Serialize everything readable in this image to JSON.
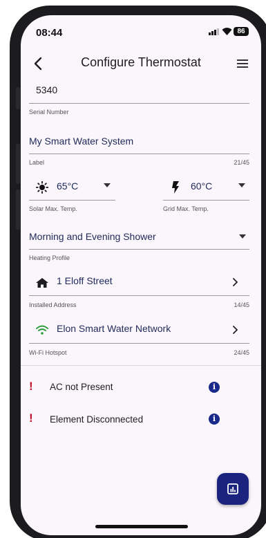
{
  "status_bar": {
    "time": "08:44",
    "battery": "86"
  },
  "header": {
    "title": "Configure Thermostat"
  },
  "serial": {
    "value": "5340",
    "label": "Serial Number"
  },
  "label_field": {
    "value": "My Smart Water System",
    "label": "Label",
    "counter": "21/45"
  },
  "solar": {
    "value": "65°C",
    "label": "Solar Max. Temp."
  },
  "grid": {
    "value": "60°C",
    "label": "Grid Max. Temp."
  },
  "heating": {
    "value": "Morning and Evening Shower",
    "label": "Heating Profile"
  },
  "address": {
    "value": "1 Eloff Street",
    "label": "Installed Address",
    "counter": "14/45"
  },
  "wifi": {
    "value": "Elon Smart Water Network",
    "label": "Wi-Fi Hotspot",
    "counter": "24/45"
  },
  "alerts": [
    {
      "mark": "!",
      "text": "AC not Present",
      "info": "i"
    },
    {
      "mark": "!",
      "text": "Element Disconnected",
      "info": "i"
    }
  ],
  "colors": {
    "accent": "#1a237e",
    "alert": "#c0102b",
    "wifi": "#2e9e3c",
    "text": "#1f2a5a"
  },
  "icons": [
    "back-arrow-icon",
    "menu-icon",
    "sun-icon",
    "lightning-icon",
    "dropdown-arrow-icon",
    "home-icon",
    "wifi-icon",
    "chevron-right-icon",
    "info-icon",
    "chart-icon"
  ]
}
